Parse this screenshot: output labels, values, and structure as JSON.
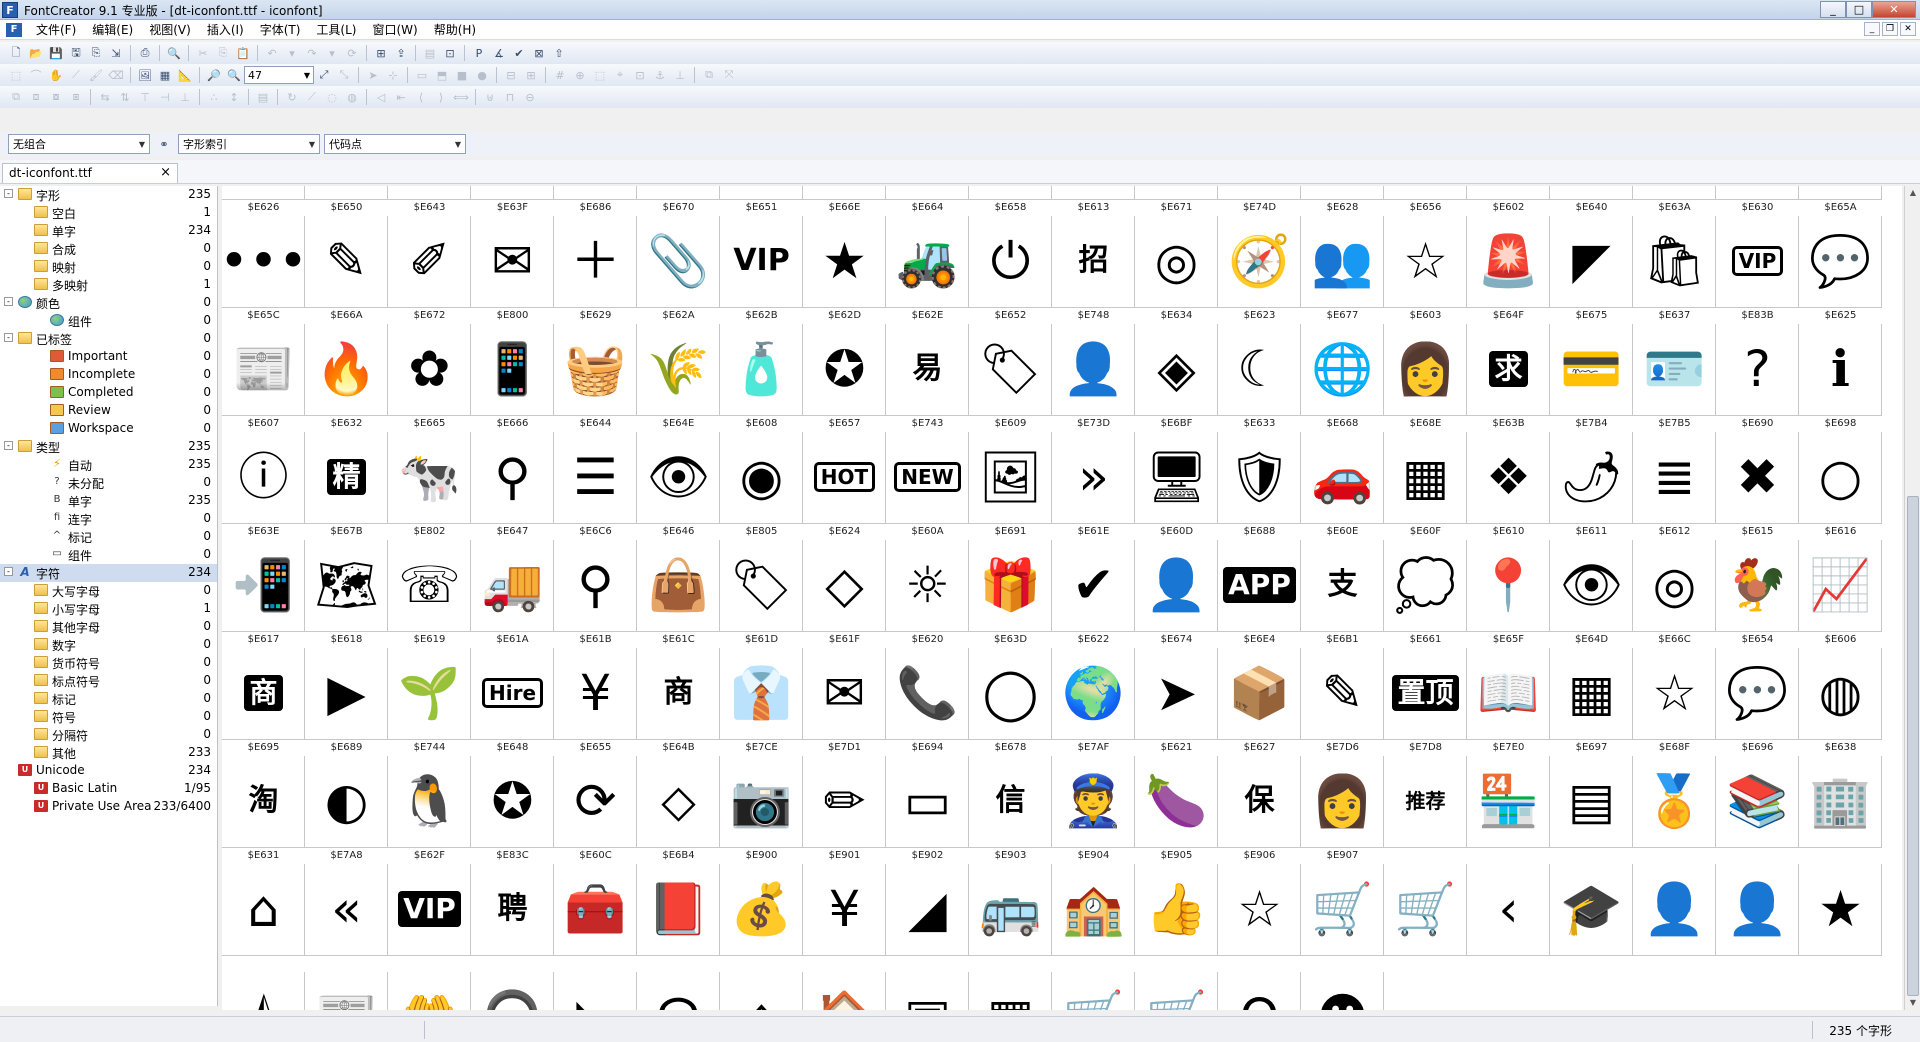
{
  "window": {
    "title": "FontCreator 9.1 专业版 - [dt-iconfont.ttf - iconfont]",
    "min": "_",
    "max": "□",
    "close": "✕"
  },
  "menu": [
    "文件(F)",
    "编辑(E)",
    "视图(V)",
    "插入(I)",
    "字体(T)",
    "工具(L)",
    "窗口(W)",
    "帮助(H)"
  ],
  "toolbar": {
    "zoom_value": "47"
  },
  "combos": {
    "combination": "无组合",
    "glyph_index": "字形索引",
    "code_point": "代码点"
  },
  "doc_tab": {
    "label": "dt-iconfont.ttf",
    "close": "×"
  },
  "tree": [
    {
      "label": "字形",
      "count": "235",
      "level": 0,
      "icon": "folder",
      "exp": "-"
    },
    {
      "label": "空白",
      "count": "1",
      "level": 1,
      "icon": "folder"
    },
    {
      "label": "单字",
      "count": "234",
      "level": 1,
      "icon": "folder"
    },
    {
      "label": "合成",
      "count": "0",
      "level": 1,
      "icon": "folder"
    },
    {
      "label": "映射",
      "count": "0",
      "level": 1,
      "icon": "folder"
    },
    {
      "label": "多映射",
      "count": "1",
      "level": 1,
      "icon": "folder"
    },
    {
      "label": "颜色",
      "count": "0",
      "level": 0,
      "icon": "globe",
      "exp": "-"
    },
    {
      "label": "组件",
      "count": "0",
      "level": 2,
      "icon": "globe"
    },
    {
      "label": "已标签",
      "count": "0",
      "level": 0,
      "icon": "folder",
      "exp": "-"
    },
    {
      "label": "Important",
      "count": "0",
      "level": 2,
      "icon": "tag",
      "color": "#e05a3a"
    },
    {
      "label": "Incomplete",
      "count": "0",
      "level": 2,
      "icon": "tag",
      "color": "#f08a2a"
    },
    {
      "label": "Completed",
      "count": "0",
      "level": 2,
      "icon": "tag",
      "color": "#7cc04a"
    },
    {
      "label": "Review",
      "count": "0",
      "level": 2,
      "icon": "tag",
      "color": "#f2c94c"
    },
    {
      "label": "Workspace",
      "count": "0",
      "level": 2,
      "icon": "tag",
      "color": "#5aa0e0"
    },
    {
      "label": "类型",
      "count": "235",
      "level": 0,
      "icon": "folder",
      "exp": "-"
    },
    {
      "label": "自动",
      "count": "235",
      "level": 2,
      "icon": "bolt",
      "glyph": "⚡"
    },
    {
      "label": "未分配",
      "count": "0",
      "level": 2,
      "icon": "glyph",
      "glyph": "?"
    },
    {
      "label": "单字",
      "count": "235",
      "level": 2,
      "icon": "glyph",
      "glyph": "B"
    },
    {
      "label": "连字",
      "count": "0",
      "level": 2,
      "icon": "glyph",
      "glyph": "fi"
    },
    {
      "label": "标记",
      "count": "0",
      "level": 2,
      "icon": "glyph",
      "glyph": "^"
    },
    {
      "label": "组件",
      "count": "0",
      "level": 2,
      "icon": "glyph",
      "glyph": "▭"
    },
    {
      "label": "字符",
      "count": "234",
      "level": 0,
      "icon": "aicon",
      "glyph": "A",
      "exp": "-",
      "selected": true
    },
    {
      "label": "大写字母",
      "count": "0",
      "level": 1,
      "icon": "folder"
    },
    {
      "label": "小写字母",
      "count": "1",
      "level": 1,
      "icon": "folder"
    },
    {
      "label": "其他字母",
      "count": "0",
      "level": 1,
      "icon": "folder"
    },
    {
      "label": "数字",
      "count": "0",
      "level": 1,
      "icon": "folder"
    },
    {
      "label": "货币符号",
      "count": "0",
      "level": 1,
      "icon": "folder"
    },
    {
      "label": "标点符号",
      "count": "0",
      "level": 1,
      "icon": "folder"
    },
    {
      "label": "标记",
      "count": "0",
      "level": 1,
      "icon": "folder"
    },
    {
      "label": "符号",
      "count": "0",
      "level": 1,
      "icon": "folder"
    },
    {
      "label": "分隔符",
      "count": "0",
      "level": 1,
      "icon": "folder"
    },
    {
      "label": "其他",
      "count": "233",
      "level": 1,
      "icon": "folder"
    },
    {
      "label": "Unicode",
      "count": "234",
      "level": 0,
      "icon": "uni",
      "glyph": "U"
    },
    {
      "label": "Basic Latin",
      "count": "1/95",
      "level": 1,
      "icon": "uni",
      "glyph": "U"
    },
    {
      "label": "Private Use Area",
      "count": "233/6400",
      "level": 1,
      "icon": "uni",
      "glyph": "U"
    }
  ],
  "glyph_rows": [
    [
      {
        "code": "$E626",
        "icon": "more-dots",
        "t": "•••"
      },
      {
        "code": "$E650",
        "icon": "pencil-icon",
        "t": "✎"
      },
      {
        "code": "$E643",
        "icon": "pencil-outline",
        "t": "✐"
      },
      {
        "code": "$E63F",
        "icon": "mail-outline",
        "t": "✉"
      },
      {
        "code": "$E686",
        "icon": "plus",
        "t": "＋"
      },
      {
        "code": "$E670",
        "icon": "paperclip",
        "t": "📎"
      },
      {
        "code": "$E651",
        "icon": "vip-text",
        "t": "VIP",
        "style": "gtext"
      },
      {
        "code": "$E66E",
        "icon": "star-filled",
        "t": "★"
      },
      {
        "code": "$E664",
        "icon": "tractor",
        "t": "🚜"
      },
      {
        "code": "$E658",
        "icon": "power",
        "t": "⏻"
      },
      {
        "code": "$E613",
        "icon": "zhao-char",
        "t": "招",
        "style": "gtext"
      },
      {
        "code": "$E671",
        "icon": "target",
        "t": "◎"
      },
      {
        "code": "$E74D",
        "icon": "compass",
        "t": "🧭"
      },
      {
        "code": "$E628",
        "icon": "users",
        "t": "👥"
      },
      {
        "code": "$E656",
        "icon": "star-outline",
        "t": "☆"
      },
      {
        "code": "$E602",
        "icon": "alarm-light",
        "t": "🚨"
      },
      {
        "code": "$E640",
        "icon": "corner-triangle",
        "t": "◤"
      },
      {
        "code": "$E63A",
        "icon": "bag-outline",
        "t": "🛍"
      },
      {
        "code": "$E630",
        "icon": "vip-boxed",
        "t": "VIP",
        "style": "gtext outlined"
      },
      {
        "code": "$E65A",
        "icon": "chat-dots",
        "t": "💬"
      }
    ],
    [
      {
        "code": "$E65C",
        "icon": "news",
        "t": "📰"
      },
      {
        "code": "$E66A",
        "icon": "flame",
        "t": "🔥"
      },
      {
        "code": "$E672",
        "icon": "aperture",
        "t": "✿"
      },
      {
        "code": "$E800",
        "icon": "phone",
        "t": "📱"
      },
      {
        "code": "$E629",
        "icon": "basket",
        "t": "🧺"
      },
      {
        "code": "$E62A",
        "icon": "wheat",
        "t": "🌾"
      },
      {
        "code": "$E62B",
        "icon": "bottle",
        "t": "🧴"
      },
      {
        "code": "$E62D",
        "icon": "badge-check",
        "t": "✪"
      },
      {
        "code": "$E62E",
        "icon": "yi-char",
        "t": "易",
        "style": "gtext"
      },
      {
        "code": "$E652",
        "icon": "tag",
        "t": "🏷"
      },
      {
        "code": "$E748",
        "icon": "user-outline",
        "t": "👤"
      },
      {
        "code": "$E634",
        "icon": "mat",
        "t": "◈"
      },
      {
        "code": "$E623",
        "icon": "moon-stars",
        "t": "☾"
      },
      {
        "code": "$E677",
        "icon": "globe-circle",
        "t": "🌐"
      },
      {
        "code": "$E603",
        "icon": "support-agent",
        "t": "👩"
      },
      {
        "code": "$E64F",
        "icon": "qiu-char",
        "t": "求",
        "style": "gtext boxed"
      },
      {
        "code": "$E675",
        "icon": "card",
        "t": "💳"
      },
      {
        "code": "$E637",
        "icon": "id-card-check",
        "t": "🪪"
      },
      {
        "code": "$E83B",
        "icon": "question-circle",
        "t": "?"
      },
      {
        "code": "$E625",
        "icon": "info-filled",
        "t": "ℹ"
      }
    ],
    [
      {
        "code": "$E607",
        "icon": "info-outline",
        "t": "ⓘ"
      },
      {
        "code": "$E632",
        "icon": "jing-char",
        "t": "精",
        "style": "gtext boxed"
      },
      {
        "code": "$E665",
        "icon": "cow",
        "t": "🐄"
      },
      {
        "code": "$E666",
        "icon": "search-person",
        "t": "⚲"
      },
      {
        "code": "$E644",
        "icon": "menu-lines",
        "t": "☰"
      },
      {
        "code": "$E64E",
        "icon": "eye-filled",
        "t": "👁"
      },
      {
        "code": "$E608",
        "icon": "eye-outline",
        "t": "◉"
      },
      {
        "code": "$E657",
        "icon": "hot-badge",
        "t": "HOT",
        "style": "gtext outlined"
      },
      {
        "code": "$E743",
        "icon": "new-badge",
        "t": "NEW",
        "style": "gtext outlined"
      },
      {
        "code": "$E609",
        "icon": "image",
        "t": "🖼"
      },
      {
        "code": "$E73D",
        "icon": "chevrons-right",
        "t": "»"
      },
      {
        "code": "$E6BF",
        "icon": "monitor",
        "t": "🖥"
      },
      {
        "code": "$E633",
        "icon": "shield-check",
        "t": "🛡"
      },
      {
        "code": "$E668",
        "icon": "car",
        "t": "🚗"
      },
      {
        "code": "$E68E",
        "icon": "grid-search",
        "t": "▦"
      },
      {
        "code": "$E63B",
        "icon": "butterfly",
        "t": "❖"
      },
      {
        "code": "$E7B4",
        "icon": "chili",
        "t": "🌶"
      },
      {
        "code": "$E7B5",
        "icon": "list",
        "t": "≣"
      },
      {
        "code": "$E690",
        "icon": "close-circle",
        "t": "✖"
      },
      {
        "code": "$E698",
        "icon": "circle-outline",
        "t": "○"
      }
    ],
    [
      {
        "code": "$E63E",
        "icon": "hand-phone",
        "t": "📲"
      },
      {
        "code": "$E67B",
        "icon": "map",
        "t": "🗺"
      },
      {
        "code": "$E802",
        "icon": "phone-24",
        "t": "☏"
      },
      {
        "code": "$E647",
        "icon": "truck",
        "t": "🚚"
      },
      {
        "code": "$E6C6",
        "icon": "pin-outline",
        "t": "⚲"
      },
      {
        "code": "$E646",
        "icon": "shopping-bag",
        "t": "👜"
      },
      {
        "code": "$E805",
        "icon": "tags",
        "t": "🏷"
      },
      {
        "code": "$E624",
        "icon": "tag-outline",
        "t": "◇"
      },
      {
        "code": "$E60A",
        "icon": "sun",
        "t": "☼"
      },
      {
        "code": "$E691",
        "icon": "gift",
        "t": "🎁"
      },
      {
        "code": "$E61E",
        "icon": "check-circle",
        "t": "✔"
      },
      {
        "code": "$E60D",
        "icon": "user-badge",
        "t": "👤"
      },
      {
        "code": "$E688",
        "icon": "app-phone",
        "t": "APP",
        "style": "gtext boxed"
      },
      {
        "code": "$E60E",
        "icon": "alipay",
        "t": "支",
        "style": "gtext"
      },
      {
        "code": "$E60F",
        "icon": "chat-bubble",
        "t": "💭"
      },
      {
        "code": "$E610",
        "icon": "location-pin",
        "t": "📍"
      },
      {
        "code": "$E611",
        "icon": "eye-heart",
        "t": "👁"
      },
      {
        "code": "$E612",
        "icon": "eye-heart-outline",
        "t": "◎"
      },
      {
        "code": "$E615",
        "icon": "rooster",
        "t": "🐓"
      },
      {
        "code": "$E616",
        "icon": "chart-line",
        "t": "📈"
      }
    ],
    [
      {
        "code": "$E617",
        "icon": "shang-shield",
        "t": "商",
        "style": "gtext boxed"
      },
      {
        "code": "$E618",
        "icon": "play-circle",
        "t": "▶"
      },
      {
        "code": "$E619",
        "icon": "sprout",
        "t": "🌱"
      },
      {
        "code": "$E61A",
        "icon": "hire-sign",
        "t": "Hire",
        "style": "gtext outlined"
      },
      {
        "code": "$E61B",
        "icon": "yen-circle",
        "t": "¥"
      },
      {
        "code": "$E61C",
        "icon": "shang-char",
        "t": "商",
        "style": "gtext"
      },
      {
        "code": "$E61D",
        "icon": "business-person",
        "t": "👔"
      },
      {
        "code": "$E61F",
        "icon": "mail-filled",
        "t": "✉"
      },
      {
        "code": "$E620",
        "icon": "phone-call",
        "t": "📞"
      },
      {
        "code": "$E63D",
        "icon": "circle-thin",
        "t": "◯"
      },
      {
        "code": "$E622",
        "icon": "earth",
        "t": "🌍"
      },
      {
        "code": "$E674",
        "icon": "send-arrow",
        "t": "➤"
      },
      {
        "code": "$E6E4",
        "icon": "boxes",
        "t": "📦"
      },
      {
        "code": "$E6B1",
        "icon": "edit-box",
        "t": "✎"
      },
      {
        "code": "$E661",
        "icon": "zhiding-text",
        "t": "置顶",
        "style": "gtext boxed"
      },
      {
        "code": "$E65F",
        "icon": "book-open",
        "t": "📖"
      },
      {
        "code": "$E64D",
        "icon": "qr-code",
        "t": "▦"
      },
      {
        "code": "$E66C",
        "icon": "star-thin",
        "t": "☆"
      },
      {
        "code": "$E654",
        "icon": "wechat",
        "t": "💬"
      },
      {
        "code": "$E606",
        "icon": "weibo",
        "t": "◍"
      }
    ],
    [
      {
        "code": "$E695",
        "icon": "taobao",
        "t": "淘",
        "style": "gtext"
      },
      {
        "code": "$E689",
        "icon": "aperture-circle",
        "t": "◐"
      },
      {
        "code": "$E744",
        "icon": "qq-penguin",
        "t": "🐧"
      },
      {
        "code": "$E648",
        "icon": "z-star",
        "t": "✪"
      },
      {
        "code": "$E655",
        "icon": "refresh",
        "t": "⟳"
      },
      {
        "code": "$E64B",
        "icon": "tag-small",
        "t": "⬦"
      },
      {
        "code": "$E7CE",
        "icon": "camera",
        "t": "📷"
      },
      {
        "code": "$E7D1",
        "icon": "pencil-thin",
        "t": "✏"
      },
      {
        "code": "$E694",
        "icon": "card-outline",
        "t": "▭"
      },
      {
        "code": "$E678",
        "icon": "xin-shield",
        "t": "信",
        "style": "gtext"
      },
      {
        "code": "$E7AF",
        "icon": "officer",
        "t": "👮"
      },
      {
        "code": "$E621",
        "icon": "eggplant",
        "t": "🍆"
      },
      {
        "code": "$E627",
        "icon": "bao-shield",
        "t": "保",
        "style": "gtext"
      },
      {
        "code": "$E7D6",
        "icon": "woman",
        "t": "👩"
      },
      {
        "code": "$E7D8",
        "icon": "recommend-ribbon",
        "t": "推荐",
        "style": "gtext small"
      },
      {
        "code": "$E7E0",
        "icon": "store",
        "t": "🏪"
      },
      {
        "code": "$E697",
        "icon": "layout",
        "t": "▤"
      },
      {
        "code": "$E68F",
        "icon": "medal",
        "t": "🏅"
      },
      {
        "code": "$E696",
        "icon": "books",
        "t": "📚"
      },
      {
        "code": "$E638",
        "icon": "building",
        "t": "🏢"
      }
    ],
    [
      {
        "code": "$E631",
        "icon": "shop-outline",
        "t": "⌂"
      },
      {
        "code": "$E7A8",
        "icon": "chevrons-left",
        "t": "«"
      },
      {
        "code": "$E62F",
        "icon": "vip-card",
        "t": "VIP",
        "style": "gtext boxed"
      },
      {
        "code": "$E83C",
        "icon": "pin-char",
        "t": "聘",
        "style": "gtext"
      },
      {
        "code": "$E60C",
        "icon": "toolbox",
        "t": "🧰"
      },
      {
        "code": "$E6B4",
        "icon": "book-filled",
        "t": "📕"
      },
      {
        "code": "$E900",
        "icon": "money-bag",
        "t": "💰"
      },
      {
        "code": "$E901",
        "icon": "money-bag-outline",
        "t": "¥"
      },
      {
        "code": "$E902",
        "icon": "triangle-corner",
        "t": "◢"
      },
      {
        "code": "$E903",
        "icon": "bus",
        "t": "🚌"
      },
      {
        "code": "$E904",
        "icon": "school",
        "t": "🏫"
      },
      {
        "code": "$E905",
        "icon": "thumbs-up",
        "t": "👍"
      },
      {
        "code": "$E906",
        "icon": "star-outline-2",
        "t": "☆"
      },
      {
        "code": "$E907",
        "icon": "cart-outline",
        "t": "🛒"
      },
      {
        "code": "",
        "icon": "cart-filled",
        "t": "🛒"
      },
      {
        "code": "",
        "icon": "chevron-left",
        "t": "‹"
      },
      {
        "code": "",
        "icon": "graduation-cap",
        "t": "🎓"
      },
      {
        "code": "",
        "icon": "person-outline",
        "t": "👤"
      },
      {
        "code": "",
        "icon": "person-filled",
        "t": "👤"
      },
      {
        "code": "",
        "icon": "star-solid",
        "t": "★"
      }
    ],
    [
      {
        "code": "",
        "icon": "star-half",
        "t": "⯪"
      },
      {
        "code": "",
        "icon": "newspaper",
        "t": "📰"
      },
      {
        "code": "",
        "icon": "hand-people",
        "t": "🤲"
      },
      {
        "code": "",
        "icon": "headset-person",
        "t": "🎧"
      },
      {
        "code": "",
        "icon": "quarter-disc",
        "t": "◣"
      },
      {
        "code": "",
        "icon": "lamp",
        "t": "☊"
      },
      {
        "code": "",
        "icon": "home-outline",
        "t": "⌂"
      },
      {
        "code": "",
        "icon": "home-filled",
        "t": "🏠"
      },
      {
        "code": "",
        "icon": "apps-outline",
        "t": "▣"
      },
      {
        "code": "",
        "icon": "apps-filled",
        "t": "▦"
      },
      {
        "code": "",
        "icon": "cart-2",
        "t": "🛒"
      },
      {
        "code": "",
        "icon": "cart-3",
        "t": "🛒"
      },
      {
        "code": "",
        "icon": "omega",
        "t": "Ω"
      },
      {
        "code": "",
        "icon": "smile-bubble",
        "t": "☻"
      }
    ]
  ],
  "top_labels": [
    "$E626",
    "$E650",
    "$E643",
    "$E63F",
    "$E686",
    "$E670",
    "$E651",
    "$E66E",
    "$E664",
    "$E658",
    "$E613",
    "$E671",
    "$E74D",
    "$E628",
    "$E656",
    "$E602",
    "$E640",
    "$E63A",
    "$E630",
    "$E65A"
  ],
  "status": {
    "glyph_count": "235 个字形"
  }
}
